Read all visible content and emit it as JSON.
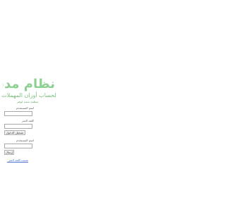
{
  "logo": {
    "title": "نظام مدفن",
    "subtitle": "لحساب أوزان المهملات",
    "tagline": "منظمة سعيد لوفتر"
  },
  "login_form": {
    "username_label": "اسم المستخدم",
    "password_label": "كلمة السر",
    "login_button_label": "تسجيل الدخول",
    "reset_email_label": "اسم المستخدم",
    "reset_button_label": "إرسال",
    "forgot_password_link": "نسيت كلمة السر ؟"
  }
}
